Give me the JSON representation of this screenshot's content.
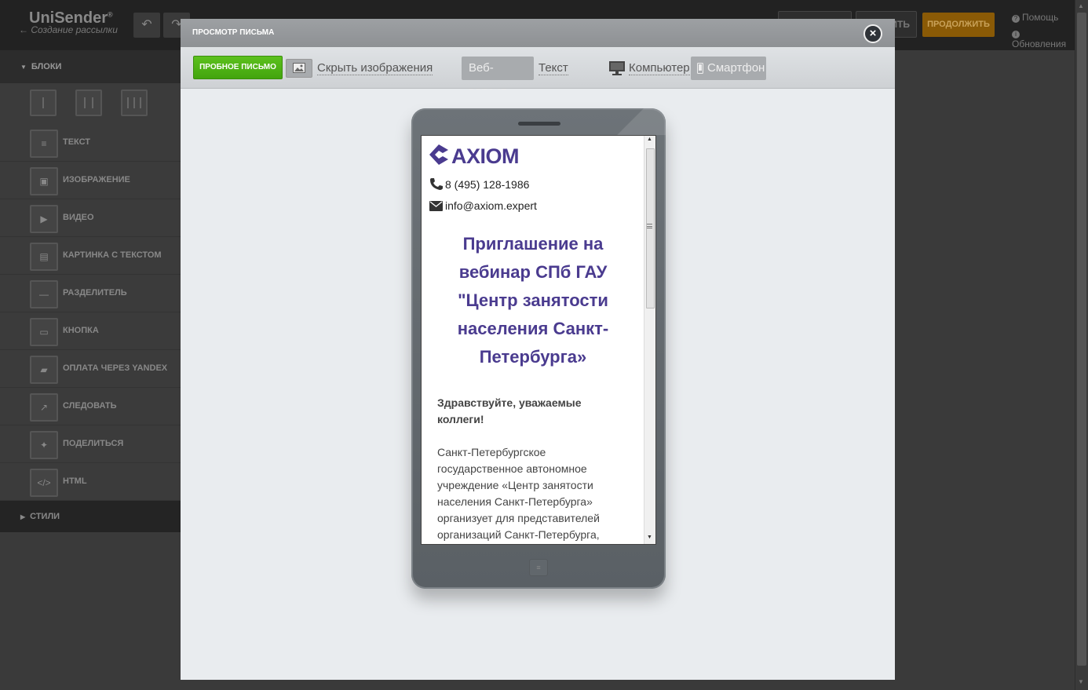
{
  "app": {
    "logo": "UniSender",
    "subtitle": "Создание рассылки",
    "continue_label": "ПРОДОЛЖИТЬ",
    "save_label": "ИТЬ",
    "help_label": "Помощь",
    "updates_label": "Обновления"
  },
  "sidebar": {
    "blocks_header": "БЛОКИ",
    "styles_header": "СТИЛИ",
    "items": [
      {
        "label": "ТЕКСТ",
        "icon": "text-icon"
      },
      {
        "label": "ИЗОБРАЖЕНИЕ",
        "icon": "image-icon"
      },
      {
        "label": "ВИДЕО",
        "icon": "video-icon"
      },
      {
        "label": "КАРТИНКА С ТЕКСТОМ",
        "icon": "image-text-icon"
      },
      {
        "label": "РАЗДЕЛИТЕЛЬ",
        "icon": "divider-icon"
      },
      {
        "label": "КНОПКА",
        "icon": "button-icon"
      },
      {
        "label": "ОПЛАТА ЧЕРЕЗ YANDEX",
        "icon": "wallet-icon"
      },
      {
        "label": "СЛЕДОВАТЬ",
        "icon": "follow-icon"
      },
      {
        "label": "ПОДЕЛИТЬСЯ",
        "icon": "twitter-icon"
      },
      {
        "label": "HTML",
        "icon": "code-icon"
      }
    ]
  },
  "modal": {
    "title": "ПРОСМОТР ПИСЬМА",
    "close": "×",
    "test_button": "ПРОБНОЕ ПИСЬМО",
    "hide_images": "Скрыть изображения",
    "web_version": "Веб-версия",
    "text_version": "Текст",
    "desktop": "Компьютер",
    "smartphone": "Смартфон"
  },
  "email": {
    "logo_text": "AXIOM",
    "phone": "8 (495) 128-1986",
    "email": "info@axiom.expert",
    "headline_lines": [
      "Приглашение на",
      "вебинар СПб ГАУ",
      "\"Центр занятости",
      "населения Санкт-",
      "Петербурга»"
    ],
    "greeting_lines": [
      "Здравствуйте, уважаемые",
      "коллеги!"
    ],
    "body_lines": [
      "Санкт-Петербургское",
      "государственное автономное",
      "учреждение «Центр занятости",
      "населения Санкт-Петербурга»",
      "организует для представителей",
      "организаций Санкт-Петербурга,"
    ]
  },
  "colors": {
    "accent_green": "#4fb415",
    "axiom_purple": "#4a3b8f",
    "continue_orange": "#8a5a06"
  }
}
